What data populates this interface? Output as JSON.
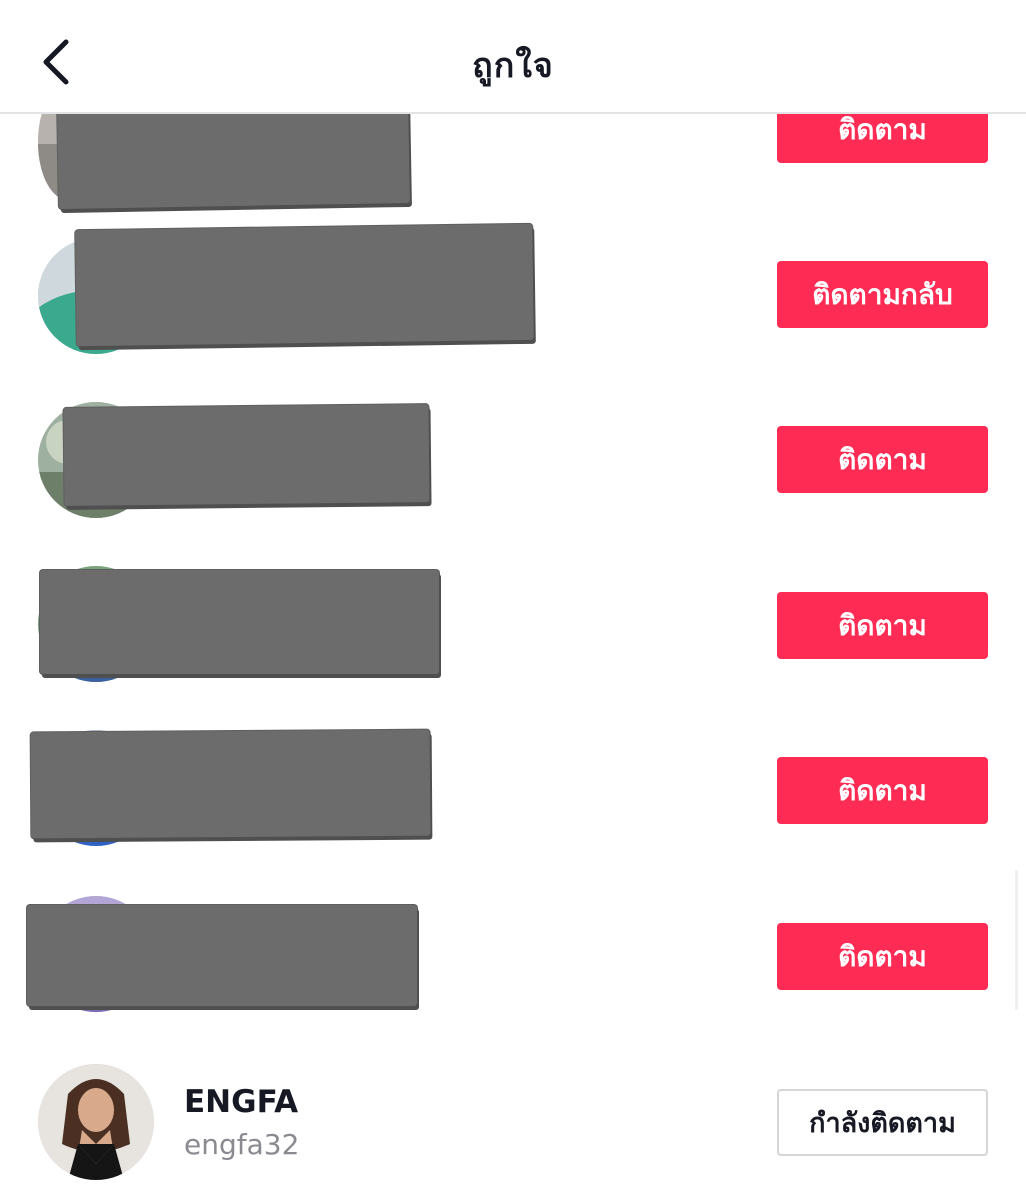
{
  "header": {
    "title": "ถูกใจ",
    "back_icon": "chevron-left-icon"
  },
  "colors": {
    "accent": "#fe2c55",
    "text_primary": "#161823",
    "text_secondary": "#8a8b91",
    "redaction": "#6c6c6c"
  },
  "users": [
    {
      "button_label": "ติดตาม",
      "button_style": "primary",
      "redacted": true
    },
    {
      "button_label": "ติดตามกลับ",
      "button_style": "primary",
      "redacted": true
    },
    {
      "button_label": "ติดตาม",
      "button_style": "primary",
      "redacted": true
    },
    {
      "button_label": "ติดตาม",
      "button_style": "primary",
      "redacted": true
    },
    {
      "button_label": "ติดตาม",
      "button_style": "primary",
      "redacted": true
    },
    {
      "button_label": "ติดตาม",
      "button_style": "primary",
      "redacted": true
    },
    {
      "display_name": "ENGFA",
      "username": "engfa32",
      "button_label": "กำลังติดตาม",
      "button_style": "outline",
      "redacted": false
    }
  ]
}
